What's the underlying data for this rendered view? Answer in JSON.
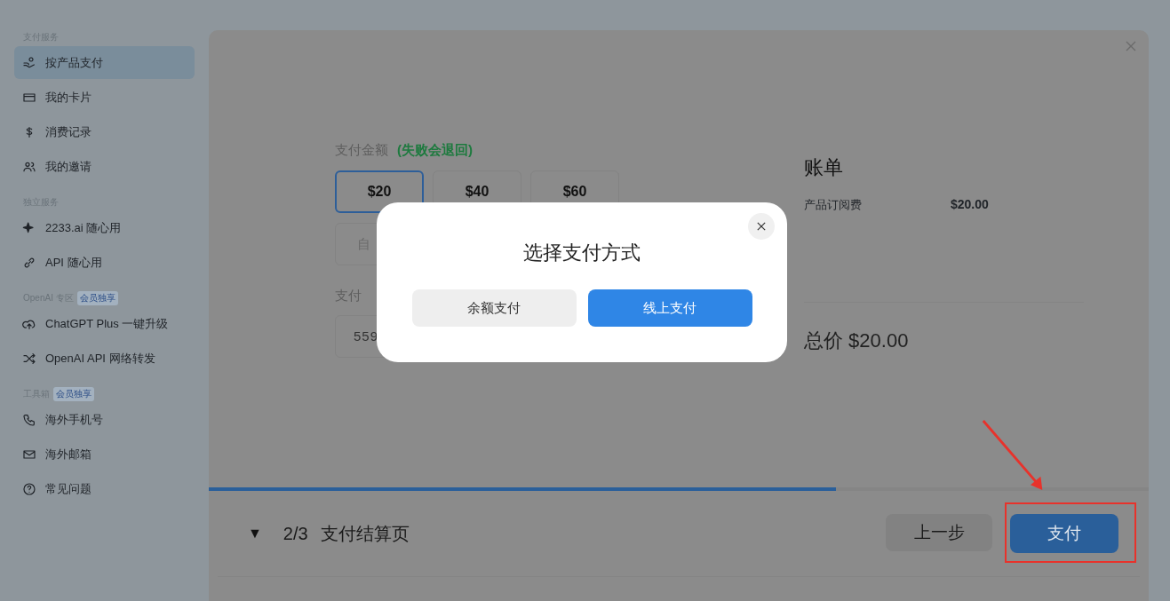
{
  "sidebar": {
    "sections": [
      {
        "title": "支付服务",
        "items": [
          {
            "label": "按产品支付",
            "selected": true
          },
          {
            "label": "我的卡片",
            "selected": false
          },
          {
            "label": "消费记录",
            "selected": false
          },
          {
            "label": "我的邀请",
            "selected": false
          }
        ]
      },
      {
        "title": "独立服务",
        "items": [
          {
            "label": "2233.ai 随心用",
            "selected": false
          },
          {
            "label": "API 随心用",
            "selected": false
          }
        ]
      },
      {
        "title": "OpenAI 专区",
        "badge": "会员独享",
        "items": [
          {
            "label": "ChatGPT Plus 一键升级",
            "selected": false
          },
          {
            "label": "OpenAI API 网络转发",
            "selected": false
          }
        ]
      },
      {
        "title": "工具箱",
        "badge": "会员独享",
        "items": [
          {
            "label": "海外手机号",
            "selected": false
          },
          {
            "label": "海外邮箱",
            "selected": false
          },
          {
            "label": "常见问题",
            "selected": false
          }
        ]
      }
    ]
  },
  "payment": {
    "amount_label": "支付金额",
    "amount_note": "(失败会退回)",
    "amounts": [
      {
        "label": "$20",
        "selected": true
      },
      {
        "label": "$40",
        "selected": false
      },
      {
        "label": "$60",
        "selected": false
      }
    ],
    "custom_amount": "自",
    "card_label": "支付",
    "card_number": "559"
  },
  "bill": {
    "title": "账单",
    "items": [
      {
        "name": "产品订阅费",
        "amount": "$20.00"
      }
    ],
    "total": "总价 $20.00"
  },
  "progress": {
    "level": 0.667
  },
  "footer": {
    "toggle": "▼",
    "step": "2/3",
    "title": "支付结算页",
    "back": "上一步",
    "pay": "支付"
  },
  "modal": {
    "title": "选择支付方式",
    "options": [
      {
        "label": "余额支付",
        "selected": false
      },
      {
        "label": "线上支付",
        "selected": true
      }
    ]
  }
}
